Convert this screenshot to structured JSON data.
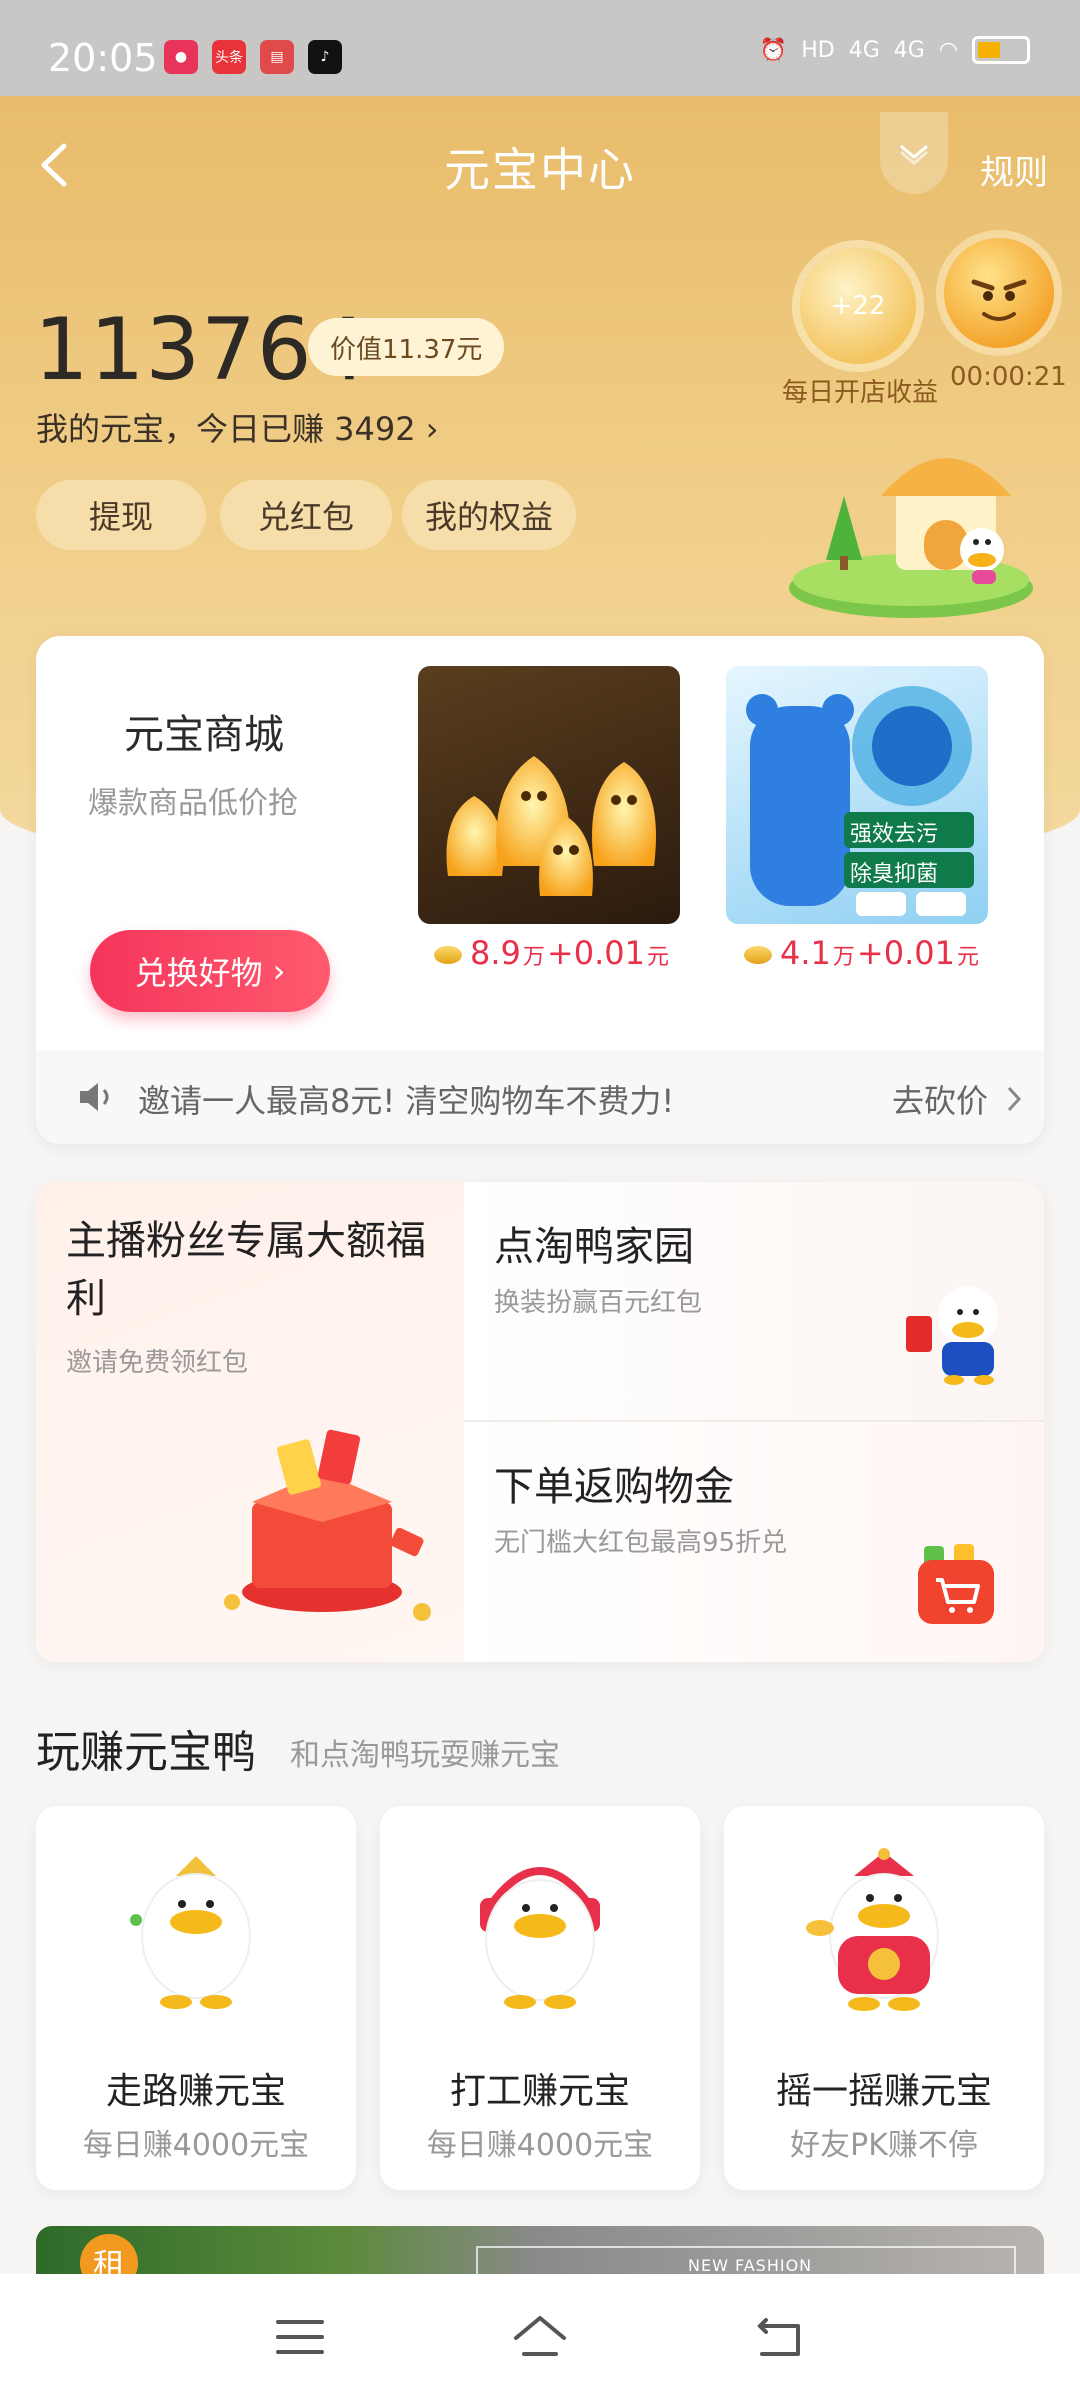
{
  "status_bar": {
    "time": "20:05",
    "apps": [
      {
        "name": "app-icon",
        "color": "#e8335a"
      },
      {
        "name": "toutiao-icon",
        "label": "头条",
        "color": "#e8333a"
      },
      {
        "name": "card-icon",
        "color": "#e04a4a"
      },
      {
        "name": "tiktok-icon",
        "color": "#111111"
      }
    ],
    "network": "4G",
    "hd": "HD"
  },
  "nav": {
    "title": "元宝中心",
    "rules": "规则"
  },
  "account": {
    "balance": "113764",
    "value": "价值11.37元",
    "earned_today": "我的元宝，今日已赚 3492",
    "shop_badge": "+22",
    "shop_income_label": "每日开店收益",
    "timer": "00:00:21"
  },
  "actions": [
    {
      "label": "提现"
    },
    {
      "label": "兑红包"
    },
    {
      "label": "我的权益"
    }
  ],
  "mall": {
    "title": "元宝商城",
    "subtitle": "爆款商品低价抢",
    "button": "兑换好物",
    "products": [
      {
        "price": "8.9",
        "unit": "万",
        "extra": "+0.01",
        "currency": "元"
      },
      {
        "price": "4.1",
        "unit": "万",
        "extra": "+0.01",
        "currency": "元",
        "tag1": "强效去污",
        "tag2": "除臭抑菌"
      }
    ],
    "ticker": "邀请一人最高8元! 清空购物车不费力!",
    "bargain": "去砍价"
  },
  "promos": {
    "left": {
      "title": "主播粉丝专属大额福利",
      "subtitle": "邀请免费领红包"
    },
    "tiles": [
      {
        "title": "点淘鸭家园",
        "subtitle": "换装扮赢百元红包"
      },
      {
        "title": "下单返购物金",
        "subtitle": "无门槛大红包最高95折兑"
      }
    ]
  },
  "games": {
    "title": "玩赚元宝鸭",
    "subtitle": "和点淘鸭玩耍赚元宝",
    "items": [
      {
        "title": "走路赚元宝",
        "subtitle": "每日赚4000元宝"
      },
      {
        "title": "打工赚元宝",
        "subtitle": "每日赚4000元宝"
      },
      {
        "title": "摇一摇赚元宝",
        "subtitle": "好友PK赚不停"
      }
    ]
  },
  "banner": {
    "badge": "租",
    "text": "NEW FASHION"
  },
  "colors": {
    "header": "#e8bc6a",
    "accent_red": "#f5355b",
    "price_red": "#e8304b"
  }
}
